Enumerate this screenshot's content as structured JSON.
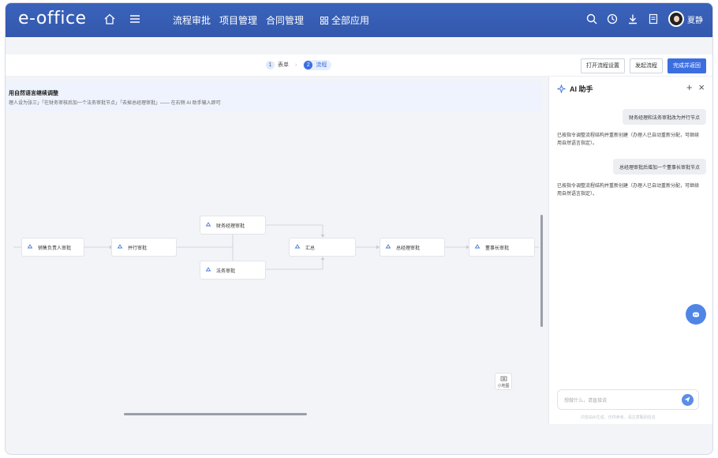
{
  "header": {
    "logo": "e-office",
    "nav": [
      "流程审批",
      "项目管理",
      "合同管理"
    ],
    "all_apps": "全部应用",
    "user_name": "夏静"
  },
  "stepbar": {
    "step1_num": "1",
    "step1_label": "表单",
    "step2_num": "2",
    "step2_label": "流程",
    "separator": "›",
    "open_settings": "打开流程设置",
    "start_flow": "发起流程",
    "finish_return": "完成并返回"
  },
  "banner": {
    "title": "用自然语言继续调整",
    "subtitle": "理人设为张三」「在财务审核后加一个法务审批节点」「去掉总经理审批」—— 在右侧 AI 助手输入即可"
  },
  "flow_nodes": {
    "sales": "销售负责人审批",
    "parallel": "并行审批",
    "finance": "财务经理审批",
    "legal": "法务审批",
    "merge": "汇总",
    "gm": "总经理审批",
    "chair": "董事长审批"
  },
  "minimap_label": "小地图",
  "ai": {
    "title": "AI 助手",
    "user_msg_1": "财务经理和法务审批改为并行节点",
    "ai_msg_1": "已按指令调整流程结构并重新创建（办理人已自动重新分配，可继续用自然语言指定）。",
    "user_msg_2": "总经理审批后增加一个董事长审批节点",
    "ai_msg_2": "已按指令调整流程结构并重新创建（办理人已自动重新分配，可继续用自然语言指定）。",
    "input_placeholder": "想做什么，请直接说",
    "footer": "内容由AI生成，仅供参考，请注意甄别信息"
  },
  "colors": {
    "header_bg": "#3558ae",
    "primary": "#3b6ee0",
    "canvas_bg": "#f3f4f7",
    "banner_bg": "#eef3fd"
  }
}
